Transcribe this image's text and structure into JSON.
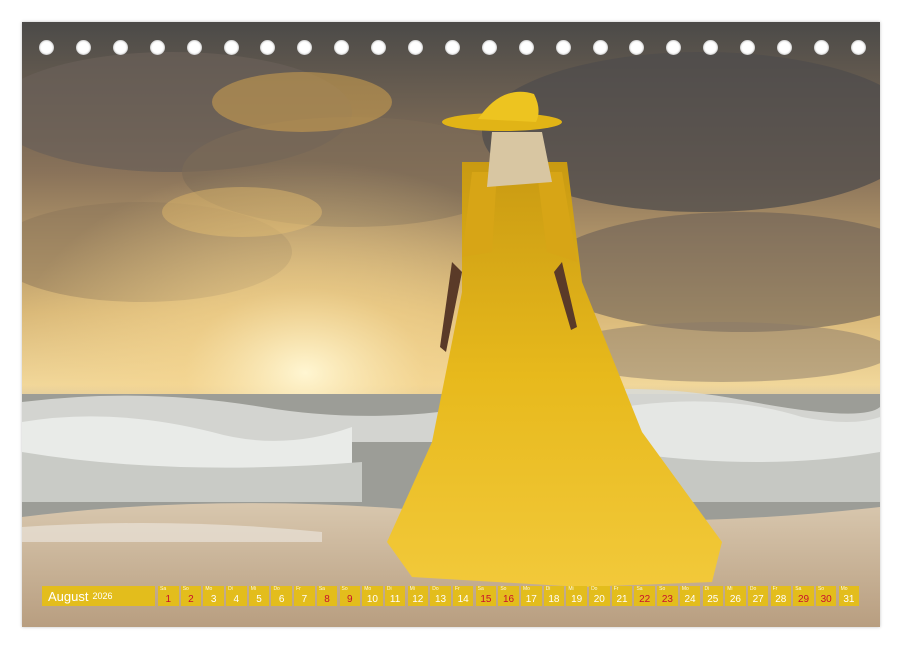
{
  "calendar": {
    "month": "August",
    "year": "2026",
    "colors": {
      "bar": "#e3bd1c",
      "text": "#ffffff",
      "weekend": "#c8102e"
    },
    "days": [
      {
        "wd": "Sa",
        "n": "1",
        "red": true
      },
      {
        "wd": "So",
        "n": "2",
        "red": true
      },
      {
        "wd": "Mo",
        "n": "3",
        "red": false
      },
      {
        "wd": "Di",
        "n": "4",
        "red": false
      },
      {
        "wd": "Mi",
        "n": "5",
        "red": false
      },
      {
        "wd": "Do",
        "n": "6",
        "red": false
      },
      {
        "wd": "Fr",
        "n": "7",
        "red": false
      },
      {
        "wd": "Sa",
        "n": "8",
        "red": true
      },
      {
        "wd": "So",
        "n": "9",
        "red": true
      },
      {
        "wd": "Mo",
        "n": "10",
        "red": false
      },
      {
        "wd": "Di",
        "n": "11",
        "red": false
      },
      {
        "wd": "Mi",
        "n": "12",
        "red": false
      },
      {
        "wd": "Do",
        "n": "13",
        "red": false
      },
      {
        "wd": "Fr",
        "n": "14",
        "red": false
      },
      {
        "wd": "Sa",
        "n": "15",
        "red": true
      },
      {
        "wd": "So",
        "n": "16",
        "red": true
      },
      {
        "wd": "Mo",
        "n": "17",
        "red": false
      },
      {
        "wd": "Di",
        "n": "18",
        "red": false
      },
      {
        "wd": "Mi",
        "n": "19",
        "red": false
      },
      {
        "wd": "Do",
        "n": "20",
        "red": false
      },
      {
        "wd": "Fr",
        "n": "21",
        "red": false
      },
      {
        "wd": "Sa",
        "n": "22",
        "red": true
      },
      {
        "wd": "So",
        "n": "23",
        "red": true
      },
      {
        "wd": "Mo",
        "n": "24",
        "red": false
      },
      {
        "wd": "Di",
        "n": "25",
        "red": false
      },
      {
        "wd": "Mi",
        "n": "26",
        "red": false
      },
      {
        "wd": "Do",
        "n": "27",
        "red": false
      },
      {
        "wd": "Fr",
        "n": "28",
        "red": false
      },
      {
        "wd": "Sa",
        "n": "29",
        "red": true
      },
      {
        "wd": "So",
        "n": "30",
        "red": true
      },
      {
        "wd": "Mo",
        "n": "31",
        "red": false
      }
    ]
  }
}
